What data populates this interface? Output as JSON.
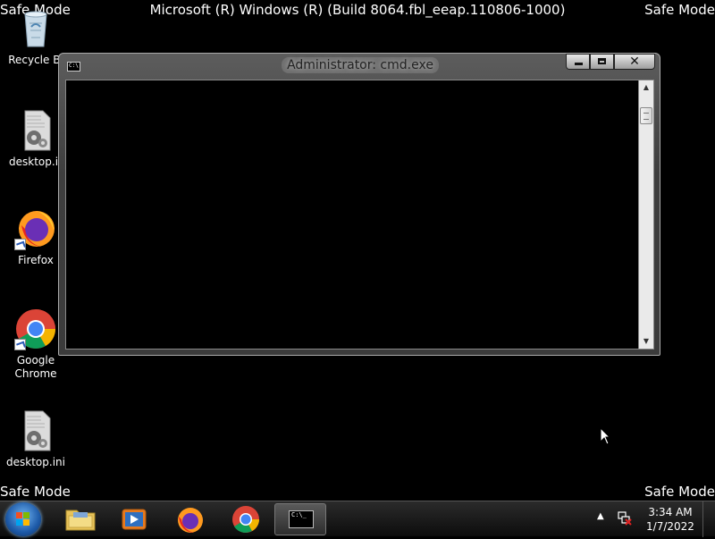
{
  "overlay": {
    "top_left": "Safe Mode",
    "top_right": "Safe Mode",
    "bottom_left": "Safe Mode",
    "bottom_right": "Safe Mode",
    "build": "Microsoft (R) Windows (R) (Build 8064.fbl_eeap.110806-1000)"
  },
  "desktop": {
    "icons": [
      {
        "label": "Recycle Bi",
        "icon": "recycle-bin-icon"
      },
      {
        "label": "desktop.ir",
        "icon": "config-file-icon"
      },
      {
        "label": "Firefox",
        "icon": "firefox-icon"
      },
      {
        "label": "Google Chrome",
        "icon": "chrome-icon"
      },
      {
        "label": "desktop.ini",
        "icon": "config-file-icon"
      }
    ]
  },
  "window": {
    "title": "Administrator: cmd.exe",
    "icon_text": "C:\\",
    "close_label": "✕"
  },
  "taskbar": {
    "apps": [
      "file-explorer-icon",
      "media-player-icon",
      "firefox-icon",
      "chrome-icon",
      "cmd-icon"
    ],
    "cmd_icon_text": "C:\\_",
    "time": "3:34 AM",
    "date": "1/7/2022"
  },
  "colors": {
    "desktop_bg": "#000000",
    "window_frame": "#4a4a4a",
    "taskbar": "#1a1a1a"
  }
}
